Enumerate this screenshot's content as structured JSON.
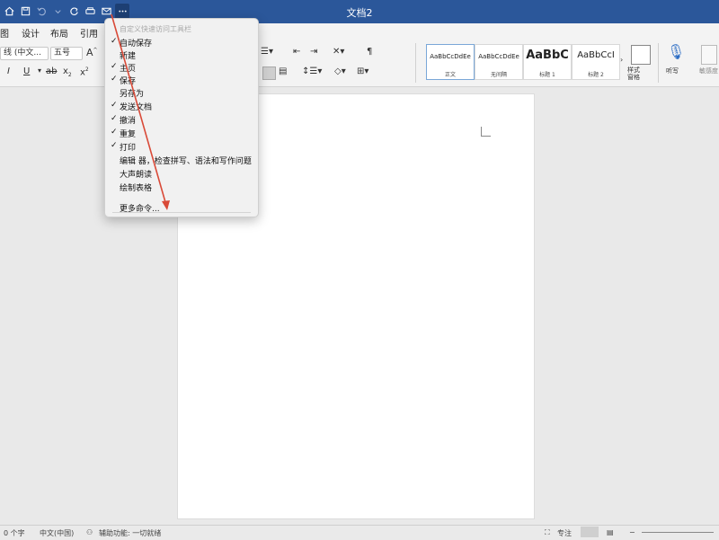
{
  "window": {
    "title": "文档2"
  },
  "tabs": [
    "图",
    "设计",
    "布局",
    "引用"
  ],
  "ribbon": {
    "font_name": "线 (中文...",
    "font_size": "五号",
    "styles": [
      {
        "preview": "AaBbCcDdEe",
        "caption": "正文"
      },
      {
        "preview": "AaBbCcDdEe",
        "caption": "无间隔"
      },
      {
        "preview": "AaBbC",
        "caption": "标题 1"
      },
      {
        "preview": "AaBbCcI",
        "caption": "标题 2"
      }
    ],
    "styles_pane_label": "样式\n窗格",
    "dictate_label": "听写",
    "sensitivity_label": "敏感度"
  },
  "qat_menu": {
    "header": "自定义快速访问工具栏",
    "items": [
      {
        "label": "自动保存",
        "checked": true
      },
      {
        "label": "新建",
        "checked": false
      },
      {
        "label": "主页",
        "checked": true
      },
      {
        "label": "保存",
        "checked": true
      },
      {
        "label": "另存为",
        "checked": false
      },
      {
        "label": "发送文档",
        "checked": true
      },
      {
        "label": "撤消",
        "checked": true
      },
      {
        "label": "重复",
        "checked": true
      },
      {
        "label": "打印",
        "checked": true
      },
      {
        "label": "编辑 器，检查拼写、语法和写作问题",
        "checked": false
      },
      {
        "label": "大声朗读",
        "checked": false
      },
      {
        "label": "绘制表格",
        "checked": false
      }
    ],
    "more": "更多命令..."
  },
  "status": {
    "words": "0 个字",
    "language": "中文(中国)",
    "accessibility": "辅助功能: 一切就绪",
    "focus": "专注"
  },
  "colors": {
    "titlebar": "#2b579a",
    "arrow": "#d94a38"
  }
}
